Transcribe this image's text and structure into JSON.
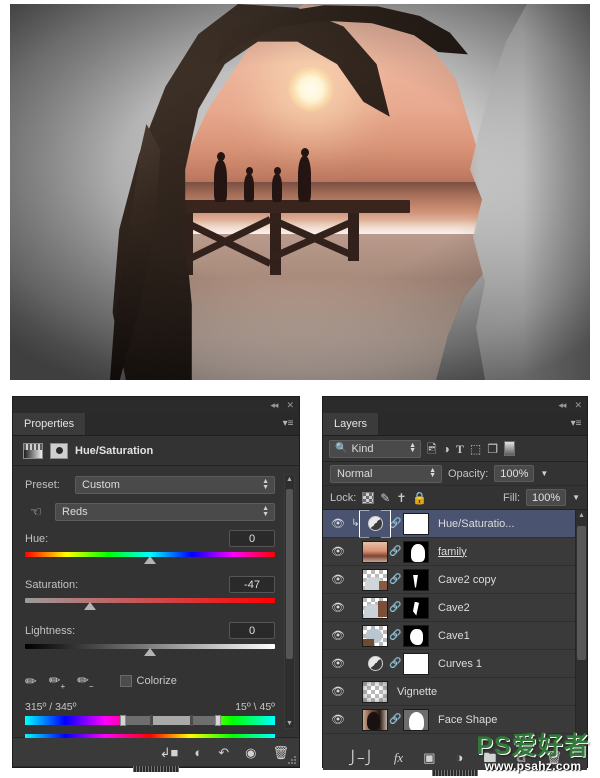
{
  "artwork": {
    "name": "double-exposure-portrait",
    "description": "Silhouette of a woman's head in profile with a sunset beach scene and family on a pier composited inside",
    "scene_elements": [
      "sun",
      "sea",
      "surf",
      "beach",
      "wooden pier",
      "family silhouettes"
    ],
    "figure_count": 4
  },
  "properties_panel": {
    "tab_label": "Properties",
    "collapse_label": "◂◂",
    "close_label": "✕",
    "menu_label": "▾≡",
    "adjustment_title": "Hue/Saturation",
    "adjustment_thumb_icon": "adjustment-layer-thumbnail-icon",
    "mask_icon": "layer-mask-icon",
    "preset": {
      "label": "Preset:",
      "value": "Custom"
    },
    "hand_icon": "on-image-adjust-hand-icon",
    "channel": {
      "value": "Reds"
    },
    "sliders": [
      {
        "label": "Hue:",
        "value": "0",
        "knob_percent": 50,
        "track": "hue"
      },
      {
        "label": "Saturation:",
        "value": "-47",
        "knob_percent": 26,
        "track": "saturation"
      },
      {
        "label": "Lightness:",
        "value": "0",
        "knob_percent": 50,
        "track": "lightness"
      }
    ],
    "eyedroppers": [
      {
        "name": "eyedropper-icon",
        "glyph": "✒"
      },
      {
        "name": "eyedropper-add-icon",
        "glyph": "✒"
      },
      {
        "name": "eyedropper-subtract-icon",
        "glyph": "✒"
      }
    ],
    "colorize": {
      "label": "Colorize",
      "checked": false
    },
    "range": {
      "left_value": "315º / 345º",
      "right_value": "15º \\ 45º"
    },
    "footer_icons": [
      {
        "name": "clip-to-layer-icon",
        "glyph": "↳"
      },
      {
        "name": "toggle-previous-state-icon",
        "glyph": "◔"
      },
      {
        "name": "reset-adjustment-icon",
        "glyph": "↺"
      },
      {
        "name": "toggle-visibility-icon",
        "glyph": "◉"
      },
      {
        "name": "delete-adjustment-icon",
        "glyph": "Ὕ1"
      }
    ]
  },
  "layers_panel": {
    "tab_label": "Layers",
    "collapse_label": "◂◂",
    "close_label": "✕",
    "menu_label": "▾≡",
    "filter": {
      "search_icon": "search-icon",
      "kind_label": "Kind",
      "type_icons": [
        {
          "name": "filter-pixel-layers-icon",
          "glyph": "Ὓc"
        },
        {
          "name": "filter-adjustment-layers-icon",
          "glyph": "◑"
        },
        {
          "name": "filter-type-layers-icon",
          "glyph": "T"
        },
        {
          "name": "filter-shape-layers-icon",
          "glyph": "⬚"
        },
        {
          "name": "filter-smart-object-icon",
          "glyph": "❐"
        }
      ],
      "toggle_name": "filter-enable-toggle"
    },
    "blend": {
      "mode": "Normal",
      "opacity_label": "Opacity:",
      "opacity_value": "100%"
    },
    "lock": {
      "label": "Lock:",
      "icons": [
        {
          "name": "lock-transparent-pixels-icon",
          "glyph": ""
        },
        {
          "name": "lock-image-pixels-icon",
          "glyph": "✐"
        },
        {
          "name": "lock-position-icon",
          "glyph": "✥"
        },
        {
          "name": "lock-all-icon",
          "glyph": "ὑ2"
        }
      ],
      "fill_label": "Fill:",
      "fill_value": "100%"
    },
    "layers": [
      {
        "name": "Hue/Saturatio...",
        "visible": true,
        "selected": true,
        "type": "adjustment",
        "clipped": true,
        "linked": true,
        "mask": "white",
        "underline": false
      },
      {
        "name": "family",
        "visible": true,
        "selected": false,
        "type": "image-sunset",
        "clipped": false,
        "linked": true,
        "mask": "face",
        "underline": true
      },
      {
        "name": "Cave2 copy",
        "visible": true,
        "selected": false,
        "type": "image-cave",
        "clipped": false,
        "linked": true,
        "mask": "streak",
        "underline": false
      },
      {
        "name": "Cave2",
        "visible": true,
        "selected": false,
        "type": "image-cave",
        "clipped": false,
        "linked": true,
        "mask": "streak",
        "underline": false
      },
      {
        "name": "Cave1",
        "visible": true,
        "selected": false,
        "type": "image-cave",
        "clipped": false,
        "linked": true,
        "mask": "blob",
        "underline": false
      },
      {
        "name": "Curves 1",
        "visible": true,
        "selected": false,
        "type": "adjustment",
        "clipped": false,
        "linked": true,
        "mask": "white",
        "underline": false
      },
      {
        "name": "Vignette",
        "visible": true,
        "selected": false,
        "type": "vignette",
        "clipped": false,
        "linked": false,
        "mask": "none",
        "underline": false
      },
      {
        "name": "Face Shape",
        "visible": true,
        "selected": false,
        "type": "image-face",
        "clipped": false,
        "linked": true,
        "mask": "face",
        "underline": false
      }
    ],
    "footer_icons": [
      {
        "name": "link-layers-icon",
        "glyph": "⚭"
      },
      {
        "name": "layer-style-fx-icon",
        "glyph": "fx"
      },
      {
        "name": "add-layer-mask-icon",
        "glyph": "■"
      },
      {
        "name": "new-adjustment-layer-icon",
        "glyph": "◑"
      },
      {
        "name": "new-group-icon",
        "glyph": "Ὓf"
      },
      {
        "name": "new-layer-icon",
        "glyph": "⧉"
      },
      {
        "name": "delete-layer-icon",
        "glyph": "Ὕ1"
      }
    ]
  },
  "watermark": {
    "brand": "PS爱好者",
    "url": "www.psahz.com"
  }
}
